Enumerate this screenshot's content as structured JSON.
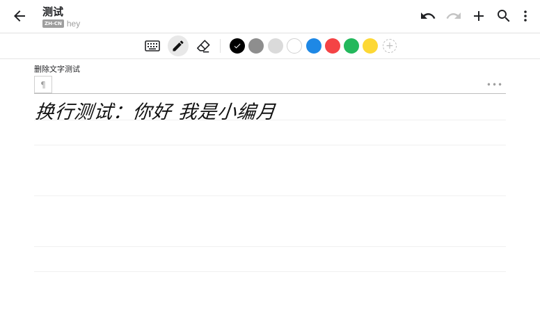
{
  "appbar": {
    "title": "测试",
    "language_badge": "ZH-CN",
    "subtitle": "hey",
    "icons": {
      "back": "arrow-left-icon",
      "undo": "undo-icon",
      "redo": "redo-icon",
      "add": "plus-icon",
      "search": "search-icon",
      "menu": "more-vertical-icon"
    }
  },
  "toolbar": {
    "tools": [
      {
        "name": "keyboard",
        "icon": "keyboard-icon",
        "active": false
      },
      {
        "name": "pen",
        "icon": "pen-icon",
        "active": true
      },
      {
        "name": "eraser",
        "icon": "eraser-icon",
        "active": false
      }
    ],
    "colors": [
      "#000000",
      "#8e8e8e",
      "#dadada",
      "#ffffff",
      "#1e88e5",
      "#f44345",
      "#23b85c",
      "#fdd835"
    ],
    "selected_color": "#000000",
    "add_color_icon": "plus-circle-icon"
  },
  "section": {
    "label": "删除文字测试",
    "paragraph_symbol": "¶",
    "more_symbol": "•••",
    "handwriting": "换行测试：你好 我是小编月"
  }
}
